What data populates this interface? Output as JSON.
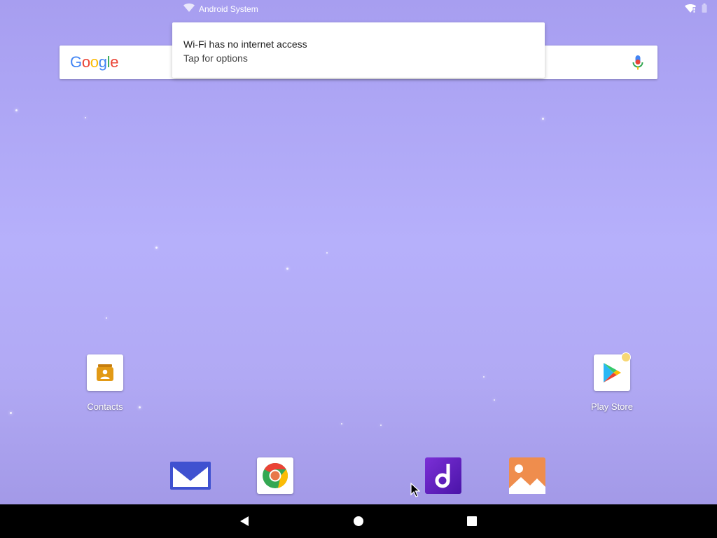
{
  "status_bar": {
    "notification_app": "Android System",
    "icons": [
      "wifi-warning-icon",
      "battery-icon"
    ]
  },
  "search_bar": {
    "logo": "Google",
    "logo_colors": [
      "#4285F4",
      "#EA4335",
      "#FBBC05",
      "#4285F4",
      "#34A853",
      "#EA4335"
    ],
    "mic_icon": "mic-icon"
  },
  "notification": {
    "title": "Wi-Fi has no internet access",
    "text": "Tap for options"
  },
  "desktop_apps": [
    {
      "label": "Contacts",
      "icon": "contacts-icon"
    },
    {
      "label": "Play Store",
      "icon": "play-store-icon"
    }
  ],
  "dock_apps": [
    {
      "icon": "email-icon"
    },
    {
      "icon": "chrome-icon"
    },
    {
      "icon": "music-icon"
    },
    {
      "icon": "gallery-icon"
    }
  ],
  "nav_bar": {
    "buttons": [
      "back-icon",
      "home-icon",
      "recents-icon"
    ]
  },
  "colors": {
    "wallpaper": "#b4adf8",
    "nav_bar": "#000000",
    "notification_bg": "#ffffff"
  }
}
